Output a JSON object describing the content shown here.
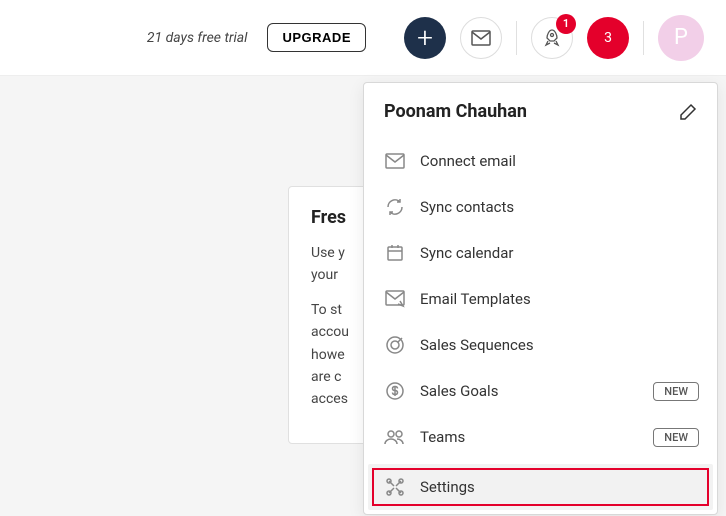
{
  "topbar": {
    "trial_text": "21 days free trial",
    "upgrade_label": "UPGRADE",
    "rocket_badge": "1",
    "red_badge": "3",
    "avatar_letter": "P"
  },
  "content": {
    "title_partial": "Fres",
    "p1_partial": "Use y",
    "p1_line2": "your",
    "p2_l1": "To st",
    "p2_l2": "accou",
    "p2_l3": "howe",
    "p2_l4": "are c",
    "p2_l5": "acces"
  },
  "dropdown": {
    "user_name": "Poonam Chauhan",
    "items": [
      {
        "id": "connect-email",
        "label": "Connect email",
        "new": false
      },
      {
        "id": "sync-contacts",
        "label": "Sync contacts",
        "new": false
      },
      {
        "id": "sync-calendar",
        "label": "Sync calendar",
        "new": false
      },
      {
        "id": "email-templates",
        "label": "Email Templates",
        "new": false
      },
      {
        "id": "sales-sequences",
        "label": "Sales Sequences",
        "new": false
      },
      {
        "id": "sales-goals",
        "label": "Sales Goals",
        "new": true
      },
      {
        "id": "teams",
        "label": "Teams",
        "new": true
      },
      {
        "id": "settings",
        "label": "Settings",
        "new": false,
        "highlighted": true
      }
    ],
    "new_label": "NEW"
  }
}
